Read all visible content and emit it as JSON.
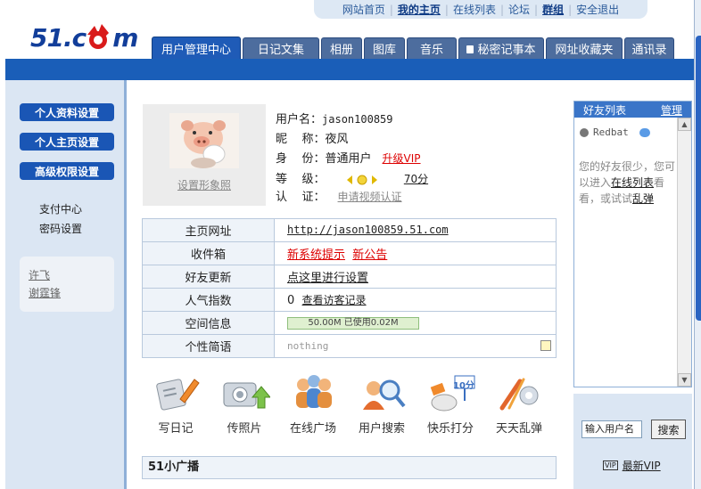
{
  "top_links": [
    "网站首页",
    "我的主页",
    "在线列表",
    "论坛",
    "群组",
    "安全退出"
  ],
  "logo": {
    "text_a": "51.c",
    "text_b": "m"
  },
  "tabs": [
    "用户管理中心",
    "日记文集",
    "相册",
    "图库",
    "音乐",
    "秘密记事本",
    "网址收藏夹",
    "通讯录"
  ],
  "active_tab": "用户管理中心",
  "sidebar": {
    "buttons": [
      "个人资料设置",
      "个人主页设置",
      "高级权限设置"
    ],
    "links": [
      "支付中心",
      "密码设置"
    ],
    "friends": [
      "许飞",
      "谢霆锋"
    ]
  },
  "profile": {
    "set_avatar": "设置形象照",
    "username_label": "用户名：",
    "username": "jason100859",
    "nickname_label": "昵    称：",
    "nickname": "夜风",
    "identity_label": "身    份：",
    "identity": "普通用户",
    "upgrade_vip": "升级VIP",
    "level_label": "等    级：",
    "level_points": "70分",
    "cert_label": "认    证：",
    "cert_link": "申请视频认证"
  },
  "info_table": {
    "homepage_label": "主页网址",
    "homepage_url": "http://jason100859.51.com",
    "inbox_label": "收件箱",
    "inbox_sys": "新系统提示",
    "inbox_ann": "新公告",
    "friend_update_label": "好友更新",
    "friend_update_link": "点这里进行设置",
    "popularity_label": "人气指数",
    "popularity_value": "0",
    "popularity_link": "查看访客记录",
    "space_label": "空间信息",
    "space_value": "50.00M 已使用0.02M",
    "space_used_fraction": 0.0004,
    "motto_label": "个性简语",
    "motto_value": "nothing"
  },
  "quick_actions": [
    "写日记",
    "传照片",
    "在线广场",
    "用户搜索",
    "快乐打分",
    "天天乱弹"
  ],
  "score_badge": "10分",
  "broadcast_title": "51小广播",
  "friend_panel": {
    "title": "好友列表",
    "manage": "管理",
    "friend_name": "Redbat",
    "msg_a": "您的好友很少，您可以进入",
    "msg_link1": "在线列表",
    "msg_b": "看看，或试试",
    "msg_link2": "乱弹"
  },
  "search": {
    "input_value": "输入用户名",
    "button": "搜索",
    "vip_badge": "VIP",
    "new_vip": "最新VIP"
  }
}
